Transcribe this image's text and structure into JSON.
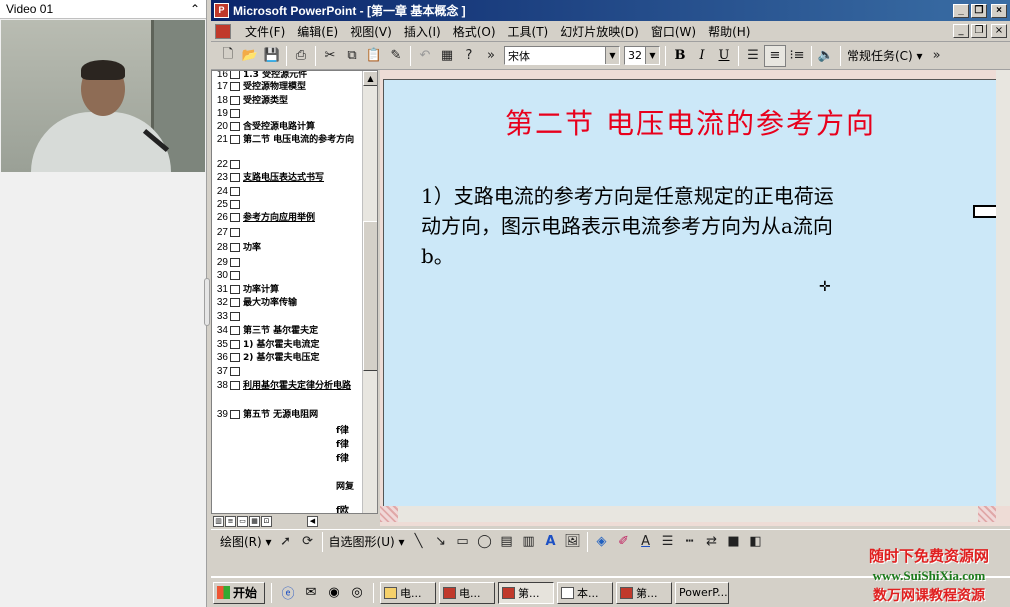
{
  "video": {
    "title": "Video 01",
    "collapse_glyph": "⌃"
  },
  "window": {
    "title": "Microsoft PowerPoint - [第一章 基本概念 ]",
    "btn_min": "_",
    "btn_max": "❐",
    "btn_close": "×"
  },
  "menu": {
    "items": [
      "文件(F)",
      "编辑(E)",
      "视图(V)",
      "插入(I)",
      "格式(O)",
      "工具(T)",
      "幻灯片放映(D)",
      "窗口(W)",
      "帮助(H)"
    ]
  },
  "toolbar": {
    "font": "宋体",
    "size": "32",
    "bold": "B",
    "italic": "I",
    "underline": "U",
    "common_tasks": "常规任务(C) ▾",
    "more": "»"
  },
  "outline": {
    "rows": [
      {
        "n": "16",
        "t": "1.3  受控源元件",
        "u": false
      },
      {
        "n": "17",
        "t": "受控源物理模型",
        "u": false
      },
      {
        "n": "18",
        "t": "受控源类型",
        "u": false
      },
      {
        "n": "19",
        "t": "",
        "u": false
      },
      {
        "n": "20",
        "t": "含受控源电路计算",
        "u": false
      },
      {
        "n": "21",
        "t": "第二节  电压电流的参考方向",
        "u": false
      },
      {
        "n": "22",
        "t": "",
        "u": false
      },
      {
        "n": "23",
        "t": "支路电压表达式书写",
        "u": true
      },
      {
        "n": "24",
        "t": "",
        "u": false
      },
      {
        "n": "25",
        "t": "",
        "u": false
      },
      {
        "n": "26",
        "t": "参考方向应用举例",
        "u": true
      },
      {
        "n": "27",
        "t": "",
        "u": false
      },
      {
        "n": "28",
        "t": "功率",
        "u": false
      },
      {
        "n": "29",
        "t": "",
        "u": false
      },
      {
        "n": "30",
        "t": "",
        "u": false
      },
      {
        "n": "31",
        "t": "功率计算",
        "u": false
      },
      {
        "n": "32",
        "t": "最大功率传输",
        "u": false
      },
      {
        "n": "33",
        "t": "",
        "u": false
      },
      {
        "n": "34",
        "t": "第三节  基尔霍夫定",
        "u": false
      },
      {
        "n": "35",
        "t": "1) 基尔霍夫电流定",
        "u": false
      },
      {
        "n": "36",
        "t": "2) 基尔霍夫电压定",
        "u": false
      },
      {
        "n": "37",
        "t": "",
        "u": false
      },
      {
        "n": "38",
        "t": "利用基尔霍夫定律分析电路",
        "u": true
      },
      {
        "n": "39",
        "t": "第五节  无源电阻网",
        "u": false
      }
    ],
    "fragments": [
      "f律",
      "f律",
      "f律",
      "网复",
      "f欧"
    ]
  },
  "slide": {
    "title": "第二节   电压电流的参考方向",
    "body": "1）支路电流的参考方向是任意规定的正电荷运动方向，图示电路表示电流参考方向为从a流向b。",
    "cursor_glyph": "✛"
  },
  "drawbar": {
    "draw": "绘图(R) ▾",
    "autoshapes": "自选图形(U) ▾"
  },
  "taskbar": {
    "start": "开始",
    "tasks": [
      {
        "label": "电...",
        "active": false
      },
      {
        "label": "电...",
        "active": false
      },
      {
        "label": "第...",
        "active": true
      },
      {
        "label": "本...",
        "active": false
      },
      {
        "label": "第...",
        "active": false
      },
      {
        "label": "PowerP...",
        "active": false
      }
    ]
  },
  "watermark": {
    "line1": "随时下免费资源网",
    "line2": "www.SuiShiXia.com",
    "line3": "数万网课教程资源"
  },
  "colors": {
    "slide_bg": "#cce8f8",
    "title_red": "#e8001c",
    "titlebar": "#0a246a"
  }
}
